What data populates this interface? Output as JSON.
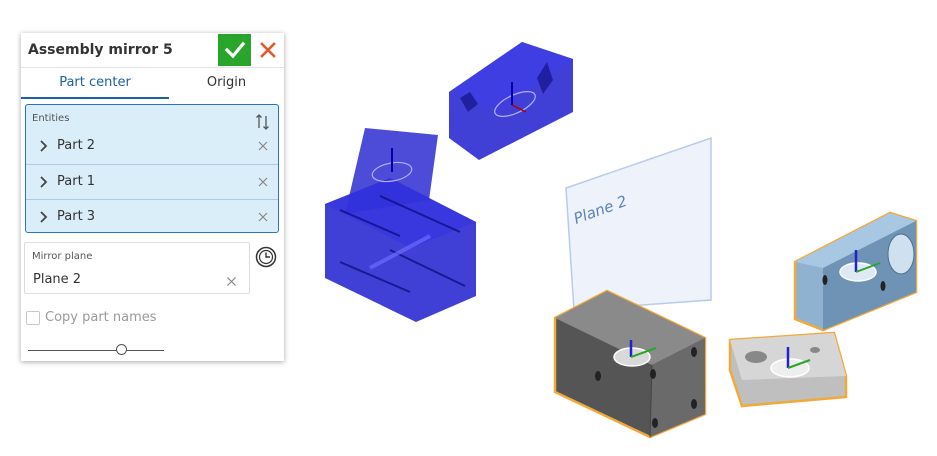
{
  "dialog": {
    "title": "Assembly mirror 5",
    "ok_icon": "check-icon",
    "cancel_icon": "close-icon",
    "accent_ok": "#29a52c",
    "accent_cancel": "#e05a2b"
  },
  "tabs": [
    {
      "label": "Part center",
      "active": true
    },
    {
      "label": "Origin",
      "active": false
    }
  ],
  "entities": {
    "label": "Entities",
    "items": [
      {
        "label": "Part 2"
      },
      {
        "label": "Part 1"
      },
      {
        "label": "Part 3"
      }
    ]
  },
  "mirror_plane": {
    "label": "Mirror plane",
    "value": "Plane 2"
  },
  "copy_part_names": {
    "label": "Copy part names",
    "checked": false
  },
  "slider": {
    "value": 0.69
  },
  "viewport": {
    "plane_label": "Plane 2",
    "selection_color": "#f2a93b",
    "mirrored_color": "#1f1fd0"
  }
}
